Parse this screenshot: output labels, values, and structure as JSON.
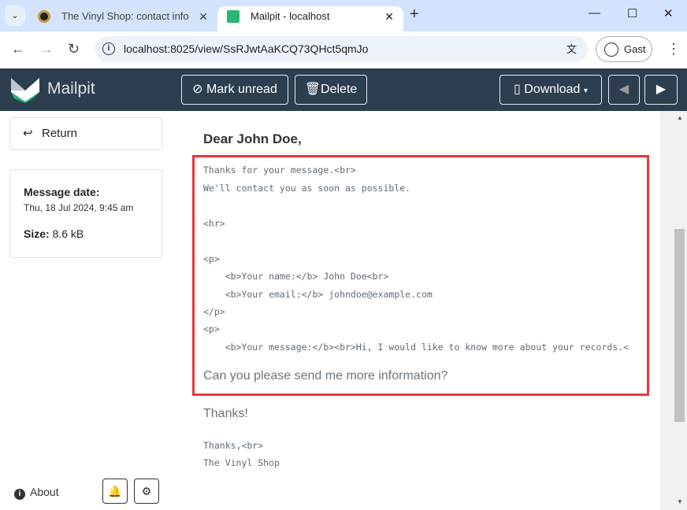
{
  "browser": {
    "tabs": [
      {
        "title": "The Vinyl Shop: contact info",
        "active": false
      },
      {
        "title": "Mailpit - localhost",
        "active": true
      }
    ],
    "url": "localhost:8025/view/SsRJwtAaKCQ73QHct5qmJo",
    "profile": "Gast"
  },
  "header": {
    "brand": "Mailpit",
    "mark_unread": "Mark unread",
    "delete": "Delete",
    "download": "Download"
  },
  "sidebar": {
    "return": "Return",
    "date_label": "Message date:",
    "date_value": "Thu, 18 Jul 2024, 9:45 am",
    "size_label": "Size:",
    "size_value": "8.6 kB",
    "about": "About"
  },
  "message": {
    "greeting": "Dear John Doe,",
    "lines": [
      "Thanks for your message.<br>",
      "We'll contact you as soon as possible.",
      "<hr>",
      "<p>",
      "    <b>Your name:</b> John Doe<br>",
      "    <b>Your email:</b> johndoe@example.com",
      "</p>",
      "<p>",
      "    <b>Your message:</b><br>Hi, I would like to know more about your records.<"
    ],
    "question": "Can you please send me more information?",
    "thanks": "Thanks!",
    "sign1": "Thanks,<br>",
    "sign2": "The Vinyl Shop"
  },
  "colors": {
    "header_bg": "#2c3e50",
    "highlight": "#e8383d",
    "brand_green": "#2bb673"
  }
}
